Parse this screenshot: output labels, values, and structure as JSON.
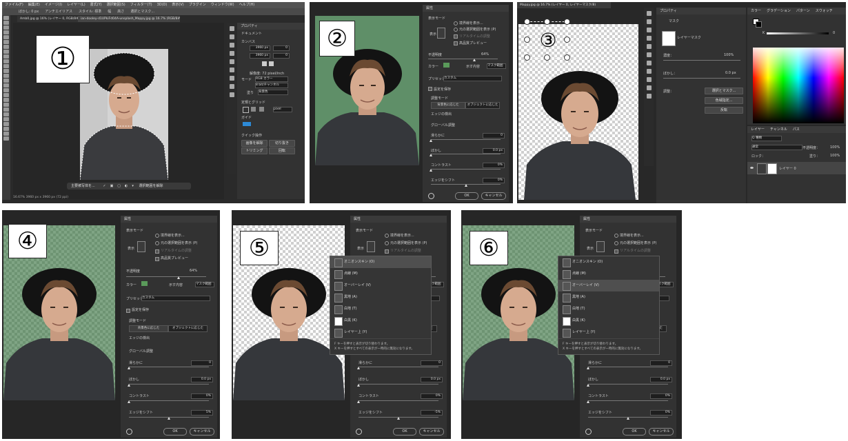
{
  "steps": [
    "①",
    "②",
    "③",
    "④",
    "⑤",
    "⑥"
  ],
  "panel1": {
    "menu": [
      "ファイル(F)",
      "編集(E)",
      "イメージ(I)",
      "レイヤー(L)",
      "書式(Y)",
      "選択範囲(S)",
      "フィルター(T)",
      "3D(D)",
      "表示(V)",
      "プラグイン",
      "ウィンドウ(W)",
      "ヘルプ(H)"
    ],
    "options": [
      "ぼかし: 0 px",
      "アンチエイリアス",
      "スタイル: 標準",
      "幅",
      "高さ",
      "選択とマスク..."
    ],
    "tab_left": "Amb0.jpg @ 16% (レイヤー 0, RGB/8#)",
    "tab_right": "ian-dooley-d1UPkiFd04A-unsplash_Mappy.jpg @ 16.7% (RGB/8#)",
    "status": "16.67%   3960 px x 3960 px (72 ppi)",
    "taskbar": [
      "主要被写体を...",
      " 選択範囲を解除"
    ],
    "props": {
      "title": "プロパティ",
      "doc": "ドキュメント",
      "canvas": "カンバス",
      "w": "3960 px",
      "h": "3960 px",
      "x": "0",
      "y": "0",
      "res": "解像度: 72 pixel/inch",
      "mode_label": "モード",
      "mode": "RGB カラー",
      "bits": "8 bit/チャンネル",
      "fill_label": "塗り",
      "fill": "背景色",
      "rulers": "定規とグリッド",
      "unit": "pixel",
      "guides": "ガイド",
      "quick": "クイック操作",
      "qa1": "画像を解除",
      "qa2": "切り抜き",
      "qa3": "トリミング",
      "qa4": "回転"
    }
  },
  "dialog": {
    "title": "属性",
    "view_mode": "表示モード",
    "view": "表示",
    "opt_edge": "境界線を表示...",
    "opt_orig": "元の選択範囲を表示 (P)",
    "opt_rt": "リアルタイムの調整",
    "opt_hq": "高品質プレビュー",
    "opacity_label": "不透明度",
    "opacity": "64%",
    "color_label": "カラー",
    "show_label": "示す内容",
    "show": "マスク範囲",
    "preset_label": "プリセット",
    "preset": "カスタム",
    "save": "設定を保存",
    "refine": "調整モード",
    "refine_a": "背景色に応じた",
    "refine_b": "オブジェクトに応じた",
    "edge": "エッジの検出",
    "global": "グローバル調整",
    "smooth": "滑らかに",
    "smooth_v": "0",
    "feather": "ぼかし",
    "feather_v": "0.0 px",
    "contrast": "コントラスト",
    "contrast_v": "0%",
    "shift": "エッジをシフト",
    "shift_v2": "0%",
    "shift_v4": "5%",
    "shift_v5": "-5%",
    "ok": "OK",
    "cancel": "キャンセル",
    "color_hex": "#5a9a5a"
  },
  "dropdown": {
    "items": [
      "オニオンスキン (O)",
      "点線 (M)",
      "オーバーレイ (V)",
      "黒地 (A)",
      "白地 (T)",
      "白黒 (K)",
      "レイヤー上 (Y)"
    ],
    "note1": "F キーを押すと表示が切り替わります。",
    "note2": "X キーを押すとすべての表示が一時的に無効になります。",
    "sel5": 0,
    "sel6": 2
  },
  "panel3": {
    "tab": "Mappy.jpg @ 16.7% (レイヤー 0, レイヤーマスク/8)",
    "props_title": "プロパティ",
    "mask": "マスク",
    "layer_mask": "レイヤーマスク",
    "density_label": "濃度：",
    "density": "100%",
    "feather_label": "ぼかし：",
    "feather": "0.0 px",
    "adjust": "調整：",
    "b1": "選択とマスク...",
    "b2": "色域指定...",
    "b3": "反転",
    "color_tabs": [
      "カラー",
      "グラデーション",
      "パターン",
      "スウォッチ"
    ],
    "k_label": "K",
    "k_value": "0",
    "layer_tabs": [
      "レイヤー",
      "チャンネル",
      "パス"
    ],
    "kind": "Q 種類",
    "blend": "通常",
    "opacity_label": "不透明度：",
    "opacity": "100%",
    "lock": "ロック：",
    "fill_label": "塗り：",
    "fill": "100%",
    "layer_name": "レイヤー 0"
  }
}
